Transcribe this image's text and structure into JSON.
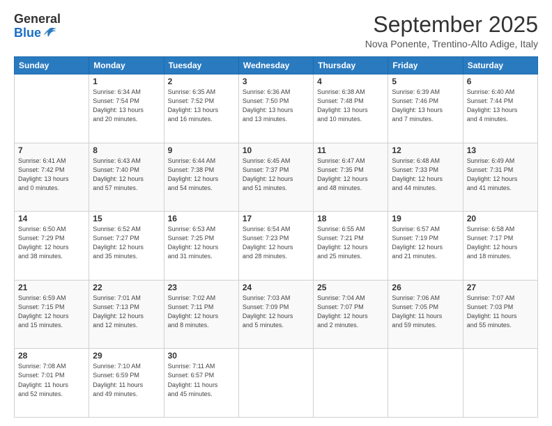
{
  "header": {
    "logo_general": "General",
    "logo_blue": "Blue",
    "month_title": "September 2025",
    "subtitle": "Nova Ponente, Trentino-Alto Adige, Italy"
  },
  "days_of_week": [
    "Sunday",
    "Monday",
    "Tuesday",
    "Wednesday",
    "Thursday",
    "Friday",
    "Saturday"
  ],
  "weeks": [
    [
      {
        "day": "",
        "info": ""
      },
      {
        "day": "1",
        "info": "Sunrise: 6:34 AM\nSunset: 7:54 PM\nDaylight: 13 hours\nand 20 minutes."
      },
      {
        "day": "2",
        "info": "Sunrise: 6:35 AM\nSunset: 7:52 PM\nDaylight: 13 hours\nand 16 minutes."
      },
      {
        "day": "3",
        "info": "Sunrise: 6:36 AM\nSunset: 7:50 PM\nDaylight: 13 hours\nand 13 minutes."
      },
      {
        "day": "4",
        "info": "Sunrise: 6:38 AM\nSunset: 7:48 PM\nDaylight: 13 hours\nand 10 minutes."
      },
      {
        "day": "5",
        "info": "Sunrise: 6:39 AM\nSunset: 7:46 PM\nDaylight: 13 hours\nand 7 minutes."
      },
      {
        "day": "6",
        "info": "Sunrise: 6:40 AM\nSunset: 7:44 PM\nDaylight: 13 hours\nand 4 minutes."
      }
    ],
    [
      {
        "day": "7",
        "info": "Sunrise: 6:41 AM\nSunset: 7:42 PM\nDaylight: 13 hours\nand 0 minutes."
      },
      {
        "day": "8",
        "info": "Sunrise: 6:43 AM\nSunset: 7:40 PM\nDaylight: 12 hours\nand 57 minutes."
      },
      {
        "day": "9",
        "info": "Sunrise: 6:44 AM\nSunset: 7:38 PM\nDaylight: 12 hours\nand 54 minutes."
      },
      {
        "day": "10",
        "info": "Sunrise: 6:45 AM\nSunset: 7:37 PM\nDaylight: 12 hours\nand 51 minutes."
      },
      {
        "day": "11",
        "info": "Sunrise: 6:47 AM\nSunset: 7:35 PM\nDaylight: 12 hours\nand 48 minutes."
      },
      {
        "day": "12",
        "info": "Sunrise: 6:48 AM\nSunset: 7:33 PM\nDaylight: 12 hours\nand 44 minutes."
      },
      {
        "day": "13",
        "info": "Sunrise: 6:49 AM\nSunset: 7:31 PM\nDaylight: 12 hours\nand 41 minutes."
      }
    ],
    [
      {
        "day": "14",
        "info": "Sunrise: 6:50 AM\nSunset: 7:29 PM\nDaylight: 12 hours\nand 38 minutes."
      },
      {
        "day": "15",
        "info": "Sunrise: 6:52 AM\nSunset: 7:27 PM\nDaylight: 12 hours\nand 35 minutes."
      },
      {
        "day": "16",
        "info": "Sunrise: 6:53 AM\nSunset: 7:25 PM\nDaylight: 12 hours\nand 31 minutes."
      },
      {
        "day": "17",
        "info": "Sunrise: 6:54 AM\nSunset: 7:23 PM\nDaylight: 12 hours\nand 28 minutes."
      },
      {
        "day": "18",
        "info": "Sunrise: 6:55 AM\nSunset: 7:21 PM\nDaylight: 12 hours\nand 25 minutes."
      },
      {
        "day": "19",
        "info": "Sunrise: 6:57 AM\nSunset: 7:19 PM\nDaylight: 12 hours\nand 21 minutes."
      },
      {
        "day": "20",
        "info": "Sunrise: 6:58 AM\nSunset: 7:17 PM\nDaylight: 12 hours\nand 18 minutes."
      }
    ],
    [
      {
        "day": "21",
        "info": "Sunrise: 6:59 AM\nSunset: 7:15 PM\nDaylight: 12 hours\nand 15 minutes."
      },
      {
        "day": "22",
        "info": "Sunrise: 7:01 AM\nSunset: 7:13 PM\nDaylight: 12 hours\nand 12 minutes."
      },
      {
        "day": "23",
        "info": "Sunrise: 7:02 AM\nSunset: 7:11 PM\nDaylight: 12 hours\nand 8 minutes."
      },
      {
        "day": "24",
        "info": "Sunrise: 7:03 AM\nSunset: 7:09 PM\nDaylight: 12 hours\nand 5 minutes."
      },
      {
        "day": "25",
        "info": "Sunrise: 7:04 AM\nSunset: 7:07 PM\nDaylight: 12 hours\nand 2 minutes."
      },
      {
        "day": "26",
        "info": "Sunrise: 7:06 AM\nSunset: 7:05 PM\nDaylight: 11 hours\nand 59 minutes."
      },
      {
        "day": "27",
        "info": "Sunrise: 7:07 AM\nSunset: 7:03 PM\nDaylight: 11 hours\nand 55 minutes."
      }
    ],
    [
      {
        "day": "28",
        "info": "Sunrise: 7:08 AM\nSunset: 7:01 PM\nDaylight: 11 hours\nand 52 minutes."
      },
      {
        "day": "29",
        "info": "Sunrise: 7:10 AM\nSunset: 6:59 PM\nDaylight: 11 hours\nand 49 minutes."
      },
      {
        "day": "30",
        "info": "Sunrise: 7:11 AM\nSunset: 6:57 PM\nDaylight: 11 hours\nand 45 minutes."
      },
      {
        "day": "",
        "info": ""
      },
      {
        "day": "",
        "info": ""
      },
      {
        "day": "",
        "info": ""
      },
      {
        "day": "",
        "info": ""
      }
    ]
  ]
}
